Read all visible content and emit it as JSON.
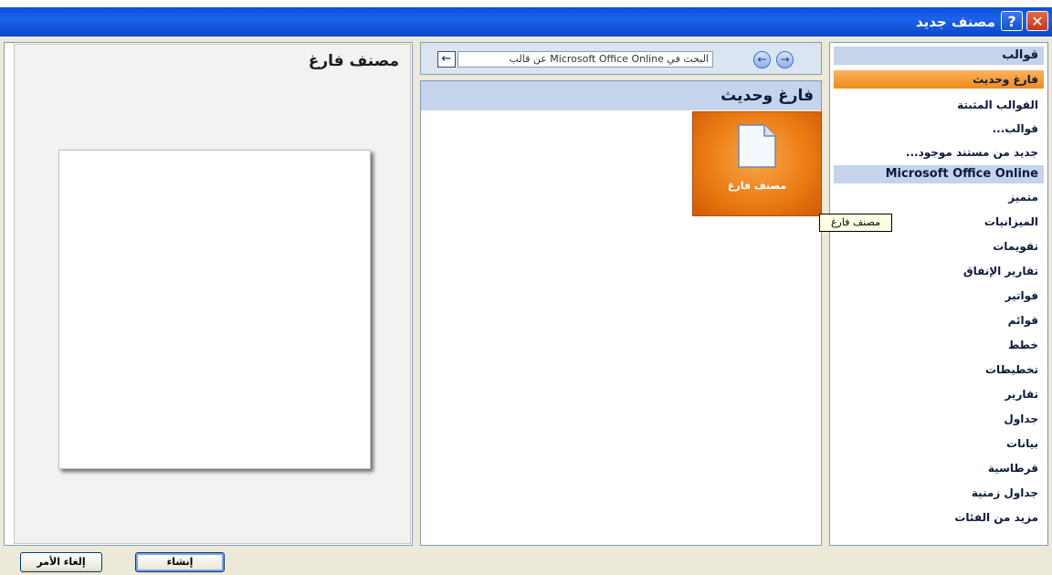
{
  "window": {
    "title": "مصنف جديد",
    "help_label": "?",
    "close_label": "✕"
  },
  "sidebar": {
    "header": "قوالب",
    "items": [
      {
        "label": "فارغ وحديث",
        "selected": true
      },
      {
        "label": "القوالب المثبتة"
      },
      {
        "label": "قوالب..."
      },
      {
        "label": "جديد من مستند موجود..."
      }
    ],
    "online_header": "Microsoft Office Online",
    "online_items": [
      {
        "label": "متميز"
      },
      {
        "label": "الميزانيات"
      },
      {
        "label": "تقويمات"
      },
      {
        "label": "تقارير الإنفاق"
      },
      {
        "label": "فواتير"
      },
      {
        "label": "قوائم"
      },
      {
        "label": "خطط"
      },
      {
        "label": "تخطيطات"
      },
      {
        "label": "تقارير"
      },
      {
        "label": "جداول"
      },
      {
        "label": "بيانات"
      },
      {
        "label": "قرطاسية"
      },
      {
        "label": "جداول زمنية"
      },
      {
        "label": "مزيد من الفئات"
      }
    ]
  },
  "search": {
    "value": "البحث في Microsoft Office Online عن قالب",
    "go_label": "←",
    "back_label": "←",
    "forward_label": "→"
  },
  "main": {
    "heading": "فارغ وحديث",
    "tile_label": "مصنف فارغ",
    "tooltip": "مصنف فارغ"
  },
  "preview": {
    "title": "مصنف فارغ"
  },
  "footer": {
    "create_label": "إنشاء",
    "cancel_label": "إلغاء الأمر"
  },
  "colors": {
    "title_bar": "#0b4fd8",
    "selection": "#f08c18",
    "panel_header": "#c5d4ea"
  }
}
